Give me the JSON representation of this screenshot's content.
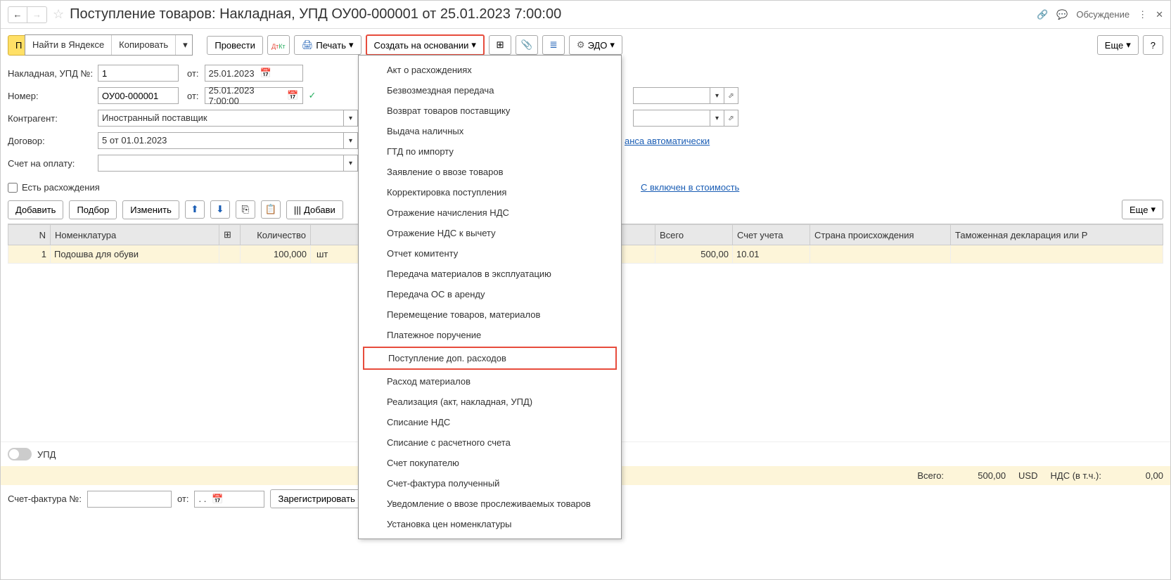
{
  "header": {
    "title": "Поступление товаров: Накладная, УПД ОУ00-000001 от 25.01.2023 7:00:00",
    "discuss": "Обсуждение"
  },
  "toolbar": {
    "yellow_prefix": "П",
    "context_find": "Найти в Яндексе",
    "context_copy": "Копировать",
    "provesti": "Провести",
    "print": "Печать",
    "create_based": "Создать на основании",
    "edo": "ЭДО",
    "more": "Еще",
    "help": "?"
  },
  "form": {
    "invoice_label": "Накладная, УПД №:",
    "invoice_num": "1",
    "from": "от:",
    "invoice_date": "25.01.2023",
    "number_label": "Номер:",
    "number_val": "ОУ00-000001",
    "number_date": "25.01.2023 7:00:00",
    "contragent_label": "Контрагент:",
    "contragent_val": "Иностранный поставщик",
    "dogovor_label": "Договор:",
    "dogovor_val": "5 от 01.01.2023",
    "schet_label": "Счет на оплату:",
    "discrepancy": "Есть расхождения",
    "avans_link": "анса автоматически",
    "nds_link": "С включен в стоимость"
  },
  "table_toolbar": {
    "add": "Добавить",
    "podbor": "Подбор",
    "change": "Изменить",
    "barcode_add": "Добави",
    "more": "Еще"
  },
  "table": {
    "headers": {
      "n": "N",
      "nom": "Номенклатура",
      "qty": "Количество",
      "total": "Всего",
      "account": "Счет учета",
      "country": "Страна происхождения",
      "customs": "Таможенная декларация или Р"
    },
    "row": {
      "n": "1",
      "nom": "Подошва для обуви",
      "qty": "100,000",
      "unit": "шт",
      "total": "500,00",
      "account": "10.01"
    }
  },
  "menu": {
    "items": [
      "Акт о расхождениях",
      "Безвозмездная передача",
      "Возврат товаров поставщику",
      "Выдача наличных",
      "ГТД по импорту",
      "Заявление о ввозе товаров",
      "Корректировка поступления",
      "Отражение начисления НДС",
      "Отражение НДС к вычету",
      "Отчет комитенту",
      "Передача материалов в эксплуатацию",
      "Передача ОС в аренду",
      "Перемещение товаров, материалов",
      "Платежное поручение",
      "Поступление доп. расходов",
      "Расход материалов",
      "Реализация (акт, накладная, УПД)",
      "Списание НДС",
      "Списание с расчетного счета",
      "Счет покупателю",
      "Счет-фактура полученный",
      "Уведомление о ввозе прослеживаемых товаров",
      "Установка цен номенклатуры"
    ]
  },
  "bottom": {
    "upd": "УПД"
  },
  "summary": {
    "total_label": "Всего:",
    "total_val": "500,00",
    "currency": "USD",
    "nds_label": "НДС (в т.ч.):",
    "nds_val": "0,00"
  },
  "footer": {
    "sf_label": "Счет-фактура №:",
    "from": "от:",
    "date_placeholder": ". .",
    "register": "Зарегистрировать"
  }
}
